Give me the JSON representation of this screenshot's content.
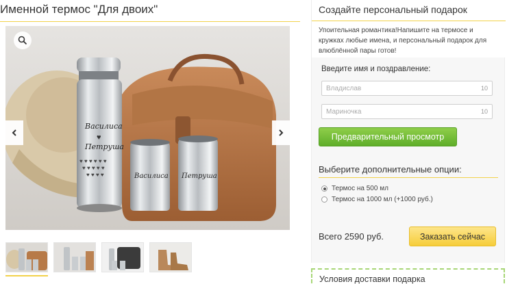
{
  "product": {
    "title": "Именной термос \"Для двоих\"",
    "thumbnails": [
      {
        "name": "thermos-set-with-bag"
      },
      {
        "name": "thermos-set-on-table"
      },
      {
        "name": "thermos-set-with-black-case"
      },
      {
        "name": "thermos-with-boots"
      }
    ],
    "engravings": {
      "thermos_top": "Василиса",
      "thermos_bottom": "Петруша",
      "cup_left": "Василиса",
      "cup_right": "Петруша"
    }
  },
  "panel": {
    "title": "Создайте персональный подарок",
    "description": "Упоительная романтика!Напишите на термосе и кружках любые имена, и персональный подарок для влюблённой пары готов!",
    "form_label": "Введите имя и поздравление:",
    "inputs": [
      {
        "placeholder": "Владислав",
        "counter": "10"
      },
      {
        "placeholder": "Мариночка",
        "counter": "10"
      }
    ],
    "preview_button": "Предварительный просмотр",
    "options_title": "Выберите дополнительные опции:",
    "options": [
      {
        "label": "Термос на 500 мл",
        "selected": true
      },
      {
        "label": "Термос на 1000 мл (+1000 руб.)",
        "selected": false
      }
    ],
    "total": "Всего 2590 руб.",
    "order_button": "Заказать сейчас",
    "delivery_title": "Условия доставки подарка"
  },
  "colors": {
    "accent_yellow": "#f2d24a",
    "preview_green": "#6fbb33",
    "order_yellow": "#f6cd3a",
    "delivery_border": "#a7d676"
  }
}
